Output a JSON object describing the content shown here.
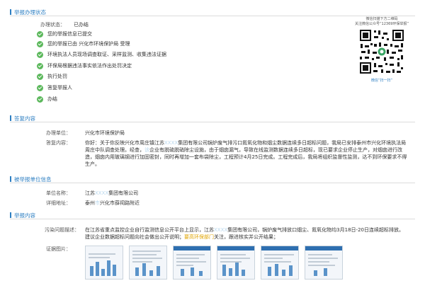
{
  "sections": {
    "status": "举报办理状态",
    "reply": "答复内容",
    "reported": "被举报单位信息",
    "report": "举报内容"
  },
  "status": {
    "label": "办理状态：",
    "value": "已办结",
    "steps": [
      "您的举报信息已提交",
      "您的举报已由 兴化市环境保护局 受理",
      "环境执法人员现场调查取证、采样监测、收集违法证据",
      "环保局根据违法事实依法作出处罚决定",
      "执行处罚",
      "答复举报人",
      "办结"
    ]
  },
  "qr": {
    "caption_line1": "微信扫描下方二维码",
    "caption_line2": "关注微信公众号“12369环保举报”",
    "footer": "微信“扫一扫”"
  },
  "reply": {
    "unit_label": "办理单位：",
    "unit_value": "兴化市环境保护局",
    "content_label": "答复内容：",
    "content_a": "你好：关于你反映兴化市周庄镇江苏",
    "content_a_blur": "XXXX",
    "content_b": "集团有限公司锅炉废气排污口氮氧化物和烟尘数据连续多日超标问题，我局已安排泰州市兴化环境执法局周庄中队调查处理。经查，",
    "content_b_blur": "该",
    "content_c": "企业有脱硫脱硝除尘设施，由于烟囱漏气，导致在线监测数据连续多日超标，现已要求企业停止生产，对烟囱进行改造，烟囱内用玻璃钢进行加固密封，同时再增加一套布袋除尘，工程预计4月25日完成。工程完成后，我局将组织监督性监测，达不到环保要求不得生产。"
  },
  "reported": {
    "name_label": "单位名称：",
    "name_a": "江苏",
    "name_blur": "XXXX",
    "name_b": "集团有限公司",
    "addr_label": "详细地址：",
    "addr_a": "泰州",
    "addr_blur": "市",
    "addr_b": "兴化市薛祠路附近"
  },
  "report": {
    "desc_label": "污染问题描述：",
    "desc_a": "在江苏省重点监控企业自行监测信息公开平台上显示，江苏",
    "desc_blur": "XXXX",
    "desc_b": "集团有限公司，锅炉废气排放口烟尘、氮氧化物均3月18日-20日连续超标排放。建议企业数据超标问题向社会做出公开说明；",
    "desc_hl": "要高环保部门",
    "desc_c": "关注，跟进核实并公开结果；",
    "evidence_label": "证据图片："
  },
  "colors": {
    "accent": "#2e7fc2",
    "check": "#5cb85c",
    "divider": "#dcdcdc"
  }
}
